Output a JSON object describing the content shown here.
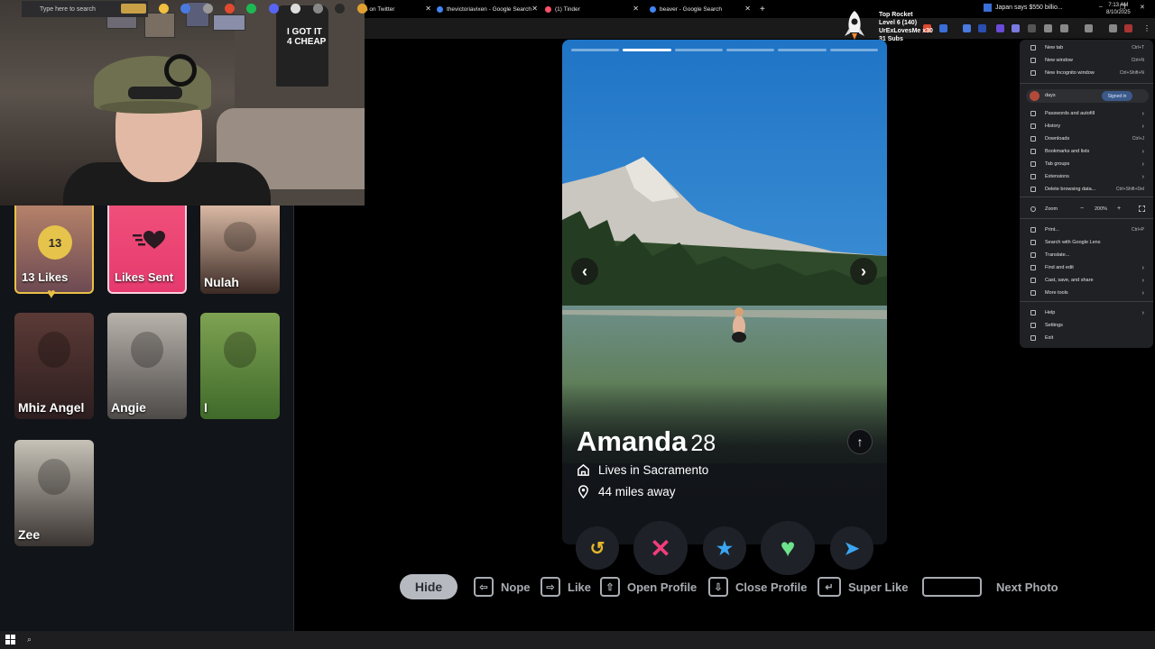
{
  "browser": {
    "tabs": [
      {
        "title": "effries on Twitter",
        "favicon_color": "#1d9bf0"
      },
      {
        "title": "thevictoriavixen - Google Search",
        "favicon_color": "#4285f4"
      },
      {
        "title": "(1) Tinder",
        "favicon_color": "#fd5068"
      },
      {
        "title": "beaver - Google Search",
        "favicon_color": "#4285f4"
      }
    ],
    "new_tab": "+",
    "window_controls": [
      "–",
      "❐",
      "✕"
    ]
  },
  "overlay": {
    "rocket": {
      "line1": "Top Rocket",
      "line2": "Level 6 (140)",
      "line3": "UrExLovesMe x30",
      "line4": "31 Subs"
    }
  },
  "webcam": {
    "shirt_text": "I GOT IT 4 CHEAP"
  },
  "likes_panel": {
    "likes_badge": "13",
    "likes_label": "13 Likes",
    "sent_label": "Likes Sent",
    "cards": [
      {
        "name": "Nulah",
        "colors": [
          "#d9b9a4",
          "#3c2b26"
        ]
      },
      {
        "name": "Mhiz Angel",
        "colors": [
          "#5b3a36",
          "#2d1e1f"
        ]
      },
      {
        "name": "Angie",
        "colors": [
          "#b8b2ab",
          "#4d4a48"
        ]
      },
      {
        "name": "I",
        "colors": [
          "#7ea252",
          "#3f6a2a"
        ]
      },
      {
        "name": "Zee",
        "colors": [
          "#c7c2b8",
          "#3a3532"
        ]
      }
    ]
  },
  "profile": {
    "name": "Amanda",
    "age": "28",
    "lives": "Lives in Sacramento",
    "distance": "44 miles away",
    "photo_index": 2,
    "photo_count": 6,
    "nav_prev": "‹",
    "nav_next": "›",
    "expand": "↑"
  },
  "actions": {
    "rewind": "↺",
    "nope": "✕",
    "superlike": "★",
    "like": "♥",
    "boost": "➤",
    "colors": {
      "rewind": "#e5b72a",
      "nope": "#f23c7b",
      "superlike": "#3aa6f3",
      "like": "#6fe28c",
      "boost": "#3aa6f3"
    }
  },
  "hints": {
    "hide": "Hide",
    "nope": "Nope",
    "like": "Like",
    "open_profile": "Open Profile",
    "close_profile": "Close Profile",
    "super_like": "Super Like",
    "next_photo": "Next Photo",
    "key_left": "⇦",
    "key_right": "⇨",
    "key_up": "⇧",
    "key_down": "⇩",
    "key_enter": "↵",
    "key_space": ""
  },
  "chrome_menu": {
    "items_top": [
      {
        "label": "New tab",
        "shortcut": "Ctrl+T"
      },
      {
        "label": "New window",
        "shortcut": "Ctrl+N"
      },
      {
        "label": "New Incognito window",
        "shortcut": "Ctrl+Shift+N"
      }
    ],
    "profile_name": "days",
    "signed_in": "Signed in",
    "items_mid": [
      {
        "label": "Passwords and autofill",
        "shortcut": "›"
      },
      {
        "label": "History",
        "shortcut": "›"
      },
      {
        "label": "Downloads",
        "shortcut": "Ctrl+J"
      },
      {
        "label": "Bookmarks and lists",
        "shortcut": "›"
      },
      {
        "label": "Tab groups",
        "shortcut": "›"
      },
      {
        "label": "Extensions",
        "shortcut": "›"
      },
      {
        "label": "Delete browsing data...",
        "shortcut": "Ctrl+Shift+Del"
      }
    ],
    "zoom_label": "Zoom",
    "zoom_minus": "−",
    "zoom_value": "200%",
    "zoom_plus": "+",
    "items_tools": [
      {
        "label": "Print...",
        "shortcut": "Ctrl+P"
      },
      {
        "label": "Search with Google Lens",
        "shortcut": ""
      },
      {
        "label": "Translate...",
        "shortcut": ""
      },
      {
        "label": "Find and edit",
        "shortcut": "›"
      },
      {
        "label": "Cast, save, and share",
        "shortcut": "›"
      },
      {
        "label": "More tools",
        "shortcut": "›"
      }
    ],
    "items_bottom": [
      {
        "label": "Help",
        "shortcut": "›"
      },
      {
        "label": "Settings",
        "shortcut": ""
      },
      {
        "label": "Exit",
        "shortcut": ""
      }
    ]
  },
  "taskbar": {
    "search_placeholder": "Type here to search",
    "news": "Japan says $550 billio...",
    "time": "7:13 AM",
    "date": "8/10/2025"
  }
}
